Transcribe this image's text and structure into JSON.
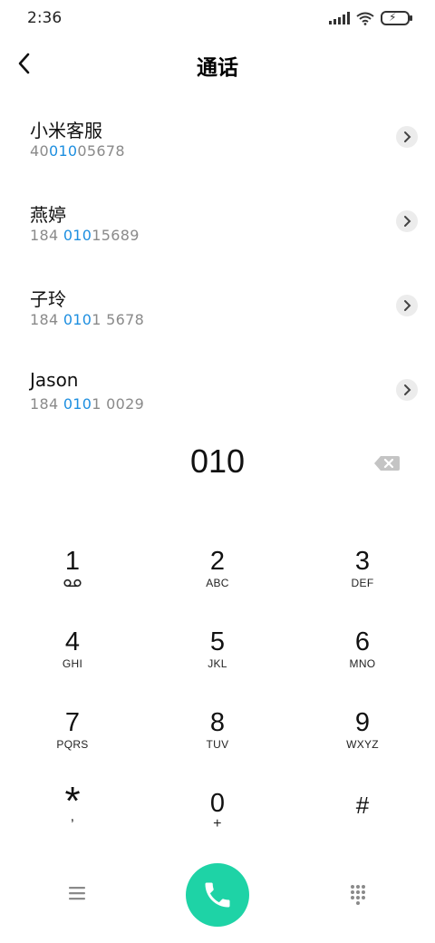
{
  "status": {
    "time": "2:36"
  },
  "header": {
    "title": "通话"
  },
  "contacts": [
    {
      "name": "小米客服",
      "num_pre": "40",
      "num_hl": "010",
      "num_post": "05678"
    },
    {
      "name": "燕婷",
      "num_pre": "184 ",
      "num_hl": "010",
      "num_post": "15689"
    },
    {
      "name": "子玲",
      "num_pre": "184 ",
      "num_hl": "010",
      "num_post": "1 5678"
    },
    {
      "name": "Jason",
      "num_pre": "184 ",
      "num_hl": "010",
      "num_post": "1 0029"
    }
  ],
  "entry": {
    "value": "010"
  },
  "keypad": [
    {
      "digit": "1",
      "letters": ""
    },
    {
      "digit": "2",
      "letters": "ABC"
    },
    {
      "digit": "3",
      "letters": "DEF"
    },
    {
      "digit": "4",
      "letters": "GHI"
    },
    {
      "digit": "5",
      "letters": "JKL"
    },
    {
      "digit": "6",
      "letters": "MNO"
    },
    {
      "digit": "7",
      "letters": "PQRS"
    },
    {
      "digit": "8",
      "letters": "TUV"
    },
    {
      "digit": "9",
      "letters": "WXYZ"
    },
    {
      "digit": "*",
      "letters": ","
    },
    {
      "digit": "0",
      "letters": "+"
    },
    {
      "digit": "#",
      "letters": ""
    }
  ],
  "colors": {
    "highlight": "#1e8fe0",
    "call_button": "#1ed3a6"
  },
  "icons": {
    "voicemail": "voicemail-icon",
    "backspace": "backspace-icon",
    "call": "phone-icon",
    "menu": "menu-icon",
    "dialpad": "dialpad-icon"
  }
}
